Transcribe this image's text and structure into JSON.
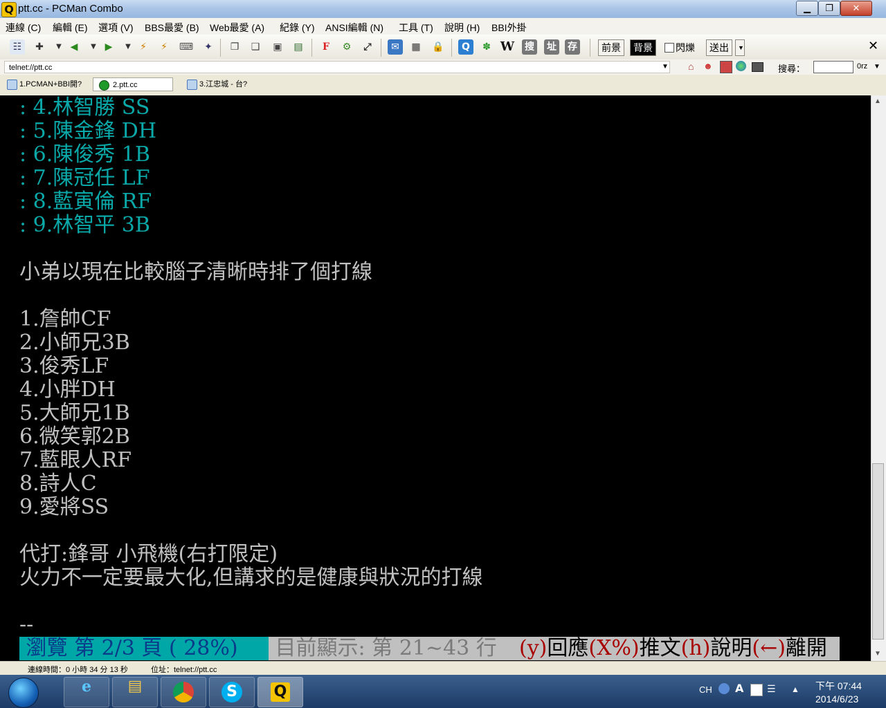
{
  "window": {
    "title": "ptt.cc - PCMan Combo"
  },
  "menu": [
    "連線 (C)",
    "編輯 (E)",
    "選項 (V)",
    "BBS最愛 (B)",
    "Web最愛 (A)",
    "紀錄 (Y)",
    "ANSI編輯 (N)",
    "工具 (T)",
    "說明 (H)",
    "BBI外掛"
  ],
  "toolbar": {
    "fg_label": "前景",
    "bg_label": "背景",
    "blink_label": "閃爍",
    "send_label": "送出",
    "search_button": "搜",
    "address_button": "址",
    "save_button": "存",
    "wiki_button": "W",
    "font_button": "F"
  },
  "address": {
    "value": "telnet://ptt.cc",
    "search_label": "搜尋：",
    "orz_label": "0rz"
  },
  "tabs": [
    "1.PCMAN+BBI開?",
    "2.ptt.cc",
    "3.江忠城 - 台?"
  ],
  "terminal": {
    "lines_cyan": [
      ": 4.林智勝 SS",
      ": 5.陳金鋒 DH",
      ": 6.陳俊秀 1B",
      ": 7.陳冠任 LF",
      ": 8.藍寅倫 RF",
      ": 9.林智平 3B"
    ],
    "intro": "小弟以現在比較腦子清晰時排了個打線",
    "lineup": [
      "1.詹帥CF",
      "2.小師兄3B",
      "3.俊秀LF",
      "4.小胖DH",
      "5.大師兄1B",
      "6.微笑郭2B",
      "7.藍眼人RF",
      "8.詩人C",
      "9.愛將SS"
    ],
    "pinch": "代打:鋒哥 小飛機(右打限定)",
    "note": "火力不一定要最大化,但講求的是健康與狀況的打線",
    "sig": "--",
    "status_left": " 瀏覽 第 2/3 頁 ( 28%)",
    "status_mid": " 目前顯示: 第 21~43 行 ",
    "status_keys": [
      {
        "key": "(y)",
        "label": "回應"
      },
      {
        "key": "(X%)",
        "label": "推文"
      },
      {
        "key": "(h)",
        "label": "說明"
      },
      {
        "key": "(←)",
        "label": "離開"
      }
    ]
  },
  "statusbar": {
    "connected": "連線時間：0 小時 34 分 13 秒",
    "address": "位址：telnet://ptt.cc"
  },
  "taskbar": {
    "lang": "CH",
    "time": "下午 07:44",
    "date": "2014/6/23"
  },
  "colors": {
    "terminal_bg": "#000000",
    "cyan": "#0aa8a8",
    "status_cyan": "#00a7a7",
    "status_gray": "#c0c0c0",
    "key_red": "#a80000"
  }
}
